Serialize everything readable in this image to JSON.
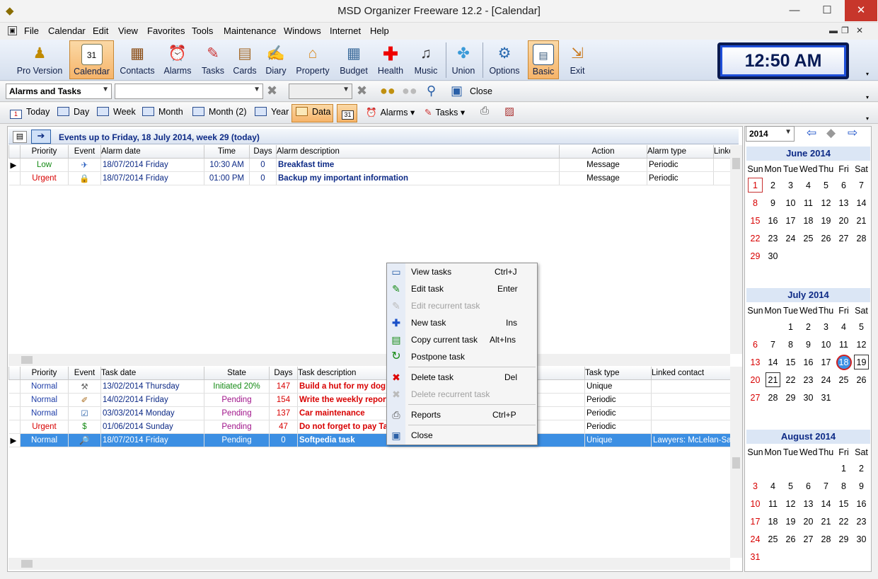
{
  "window": {
    "title": "MSD Organizer Freeware 12.2 - [Calendar]",
    "minimize": "—",
    "maximize": "☐",
    "close": "✕"
  },
  "menu": [
    "File",
    "Calendar",
    "Edit",
    "View",
    "Favorites",
    "Tools",
    "Maintenance",
    "Windows",
    "Internet",
    "Help"
  ],
  "toolbar": {
    "buttons": [
      {
        "label": "Pro Version",
        "icon": "person-icon"
      },
      {
        "label": "Calendar",
        "icon": "calendar-icon",
        "active": true
      },
      {
        "label": "Contacts",
        "icon": "contacts-icon"
      },
      {
        "label": "Alarms",
        "icon": "alarm-clock-icon"
      },
      {
        "label": "Tasks",
        "icon": "tasks-icon"
      },
      {
        "label": "Cards",
        "icon": "cards-icon"
      },
      {
        "label": "Diary",
        "icon": "diary-icon"
      },
      {
        "label": "Property",
        "icon": "house-icon"
      },
      {
        "label": "Budget",
        "icon": "calculator-icon"
      },
      {
        "label": "Health",
        "icon": "red-cross-icon"
      },
      {
        "label": "Music",
        "icon": "music-disc-icon"
      },
      {
        "label": "Union",
        "icon": "puzzle-icon"
      },
      {
        "label": "Options",
        "icon": "gears-icon"
      },
      {
        "label": "Basic",
        "icon": "window-icon",
        "active": true
      },
      {
        "label": "Exit",
        "icon": "exit-door-icon"
      }
    ],
    "clock": "12:50 AM"
  },
  "filterbar": {
    "view_select": "Alarms and Tasks",
    "search_value": "",
    "second_value": "",
    "close_label": "Close"
  },
  "viewbar": {
    "today": "Today",
    "day": "Day",
    "week": "Week",
    "month": "Month",
    "month2": "Month (2)",
    "year": "Year",
    "data": "Data",
    "alarms": "Alarms",
    "tasks": "Tasks"
  },
  "events": {
    "title": "Events up to Friday, 18 July 2014, week 29 (today)",
    "columns": [
      "Priority",
      "Event",
      "Alarm date",
      "Time",
      "Days",
      "Alarm description",
      "Action",
      "Alarm type",
      "Linked"
    ],
    "rows": [
      {
        "priority": "Low",
        "date": "18/07/2014 Friday",
        "time": "10:30 AM",
        "days": "0",
        "desc": "Breakfast time",
        "action": "Message",
        "type": "Periodic",
        "linked": ""
      },
      {
        "priority": "Urgent",
        "date": "18/07/2014 Friday",
        "time": "01:00 PM",
        "days": "0",
        "desc": "Backup my important information",
        "action": "Message",
        "type": "Periodic",
        "linked": ""
      }
    ]
  },
  "tasks": {
    "columns": [
      "Priority",
      "Event",
      "Task date",
      "State",
      "Days",
      "Task description",
      "Task type",
      "Linked contact"
    ],
    "rows": [
      {
        "priority": "Normal",
        "date": "13/02/2014 Thursday",
        "state": "Initiated 20%",
        "days": "147",
        "desc": "Build a hut for my dog",
        "type": "Unique",
        "linked": ""
      },
      {
        "priority": "Normal",
        "date": "14/02/2014 Friday",
        "state": "Pending",
        "days": "154",
        "desc": "Write the weekly report",
        "type": "Periodic",
        "linked": ""
      },
      {
        "priority": "Normal",
        "date": "03/03/2014 Monday",
        "state": "Pending",
        "days": "137",
        "desc": "Car maintenance",
        "type": "Periodic",
        "linked": ""
      },
      {
        "priority": "Urgent",
        "date": "01/06/2014 Sunday",
        "state": "Pending",
        "days": "47",
        "desc": "Do not forget to pay Taxes",
        "type": "Periodic",
        "linked": ""
      },
      {
        "priority": "Normal",
        "date": "18/07/2014 Friday",
        "state": "Pending",
        "days": "0",
        "desc": "Softpedia task",
        "type": "Unique",
        "linked": "Lawyers: McLelan-Saltm"
      }
    ]
  },
  "context_menu": [
    {
      "label": "View tasks",
      "key": "Ctrl+J",
      "enabled": true
    },
    {
      "label": "Edit task",
      "key": "Enter",
      "enabled": true
    },
    {
      "label": "Edit recurrent task",
      "key": "",
      "enabled": false
    },
    {
      "label": "New task",
      "key": "Ins",
      "enabled": true
    },
    {
      "label": "Copy current task",
      "key": "Alt+Ins",
      "enabled": true
    },
    {
      "label": "Postpone task",
      "key": "",
      "enabled": true
    },
    {
      "label": "Delete task",
      "key": "Del",
      "enabled": true
    },
    {
      "label": "Delete recurrent task",
      "key": "",
      "enabled": false
    },
    {
      "label": "Reports",
      "key": "Ctrl+P",
      "enabled": true
    },
    {
      "label": "Close",
      "key": "",
      "enabled": true
    }
  ],
  "calendar": {
    "year": "2014",
    "weekdays": [
      "Sun",
      "Mon",
      "Tue",
      "Wed",
      "Thu",
      "Fri",
      "Sat"
    ],
    "months": [
      {
        "title": "June 2014",
        "weeks": [
          [
            "1",
            "2",
            "3",
            "4",
            "5",
            "6",
            "7"
          ],
          [
            "8",
            "9",
            "10",
            "11",
            "12",
            "13",
            "14"
          ],
          [
            "15",
            "16",
            "17",
            "18",
            "19",
            "20",
            "21"
          ],
          [
            "22",
            "23",
            "24",
            "25",
            "26",
            "27",
            "28"
          ],
          [
            "29",
            "30",
            "",
            "",
            "",
            "",
            ""
          ]
        ]
      },
      {
        "title": "July 2014",
        "weeks": [
          [
            "",
            "",
            "1",
            "2",
            "3",
            "4",
            "5"
          ],
          [
            "6",
            "7",
            "8",
            "9",
            "10",
            "11",
            "12"
          ],
          [
            "13",
            "14",
            "15",
            "16",
            "17",
            "18",
            "19"
          ],
          [
            "20",
            "21",
            "22",
            "23",
            "24",
            "25",
            "26"
          ],
          [
            "27",
            "28",
            "29",
            "30",
            "31",
            "",
            ""
          ]
        ]
      },
      {
        "title": "August 2014",
        "weeks": [
          [
            "",
            "",
            "",
            "",
            "",
            "1",
            "2"
          ],
          [
            "3",
            "4",
            "5",
            "6",
            "7",
            "8",
            "9"
          ],
          [
            "10",
            "11",
            "12",
            "13",
            "14",
            "15",
            "16"
          ],
          [
            "17",
            "18",
            "19",
            "20",
            "21",
            "22",
            "23"
          ],
          [
            "24",
            "25",
            "26",
            "27",
            "28",
            "29",
            "30"
          ],
          [
            "31",
            "",
            "",
            "",
            "",
            "",
            ""
          ]
        ]
      }
    ]
  },
  "colors": {
    "accent": "#3c8fe3",
    "active_button": "#f6b46a",
    "urgent": "#d80000",
    "low": "#148a14"
  }
}
